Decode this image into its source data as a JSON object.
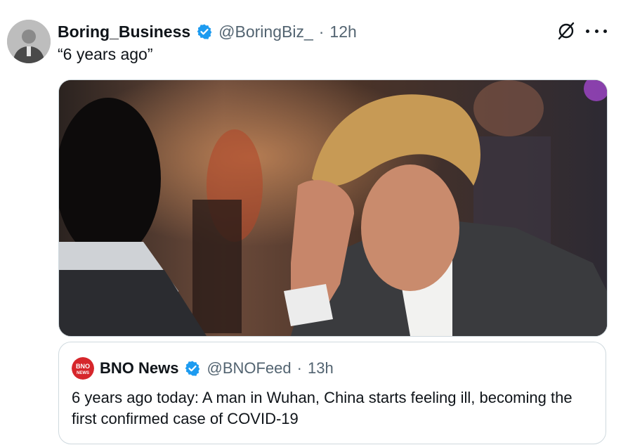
{
  "tweet": {
    "author_name": "Boring_Business",
    "handle": "@BoringBiz_",
    "separator": "·",
    "time": "12h",
    "text": "“6 years ago”",
    "icons": {
      "verified": "verified-badge-icon",
      "grok": "grok-icon",
      "more": "more-options-icon"
    }
  },
  "quote": {
    "author_name": "BNO News",
    "logo_text_top": "BNO",
    "logo_text_bottom": "NEWS",
    "handle": "@BNOFeed",
    "separator": "·",
    "time": "13h",
    "text": "6 years ago today: A man in Wuhan, China starts feeling ill, becoming the first confirmed case of COVID-19"
  },
  "colors": {
    "verified": "#1d9bf0",
    "secondary_text": "#536471",
    "border": "#cfd9de",
    "bno_red": "#d6262b"
  }
}
